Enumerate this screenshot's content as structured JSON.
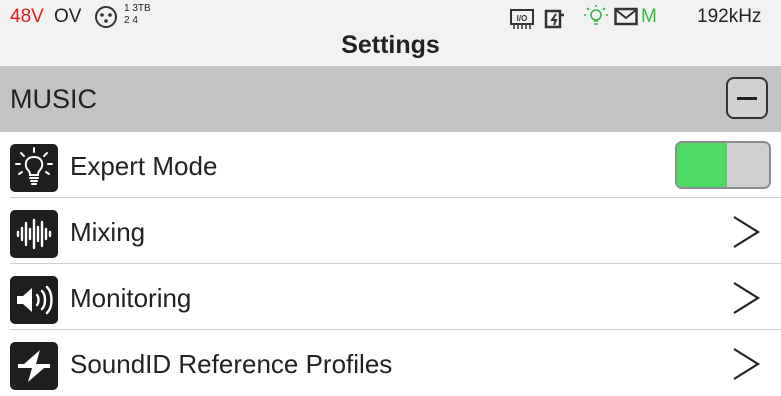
{
  "status_bar": {
    "phantom_power": "48V",
    "overload": "OV",
    "channels_top": "1 3TB",
    "channels_bottom": "2 4",
    "mode_letter": "M",
    "sample_rate": "192kHz",
    "icons": [
      "xlr-connector-icon",
      "io-interface-icon",
      "battery-charging-icon",
      "lightbulb-icon",
      "mail-icon"
    ],
    "colors": {
      "phantom": "#e02020",
      "mode": "#3cb84a",
      "bulb": "#3cb84a"
    }
  },
  "header": {
    "title": "Settings"
  },
  "section": {
    "title": "MUSIC",
    "collapse_icon": "minus-icon"
  },
  "rows": [
    {
      "label": "Expert Mode",
      "icon": "lightbulb-icon",
      "control": "toggle",
      "toggle_on": true
    },
    {
      "label": "Mixing",
      "icon": "waveform-icon",
      "control": "chevron"
    },
    {
      "label": "Monitoring",
      "icon": "speaker-icon",
      "control": "chevron"
    },
    {
      "label": "SoundID Reference Profiles",
      "icon": "soundid-icon",
      "control": "chevron"
    }
  ],
  "colors": {
    "toggle_on": "#4cd964",
    "section_bg": "#c3c3c3"
  }
}
